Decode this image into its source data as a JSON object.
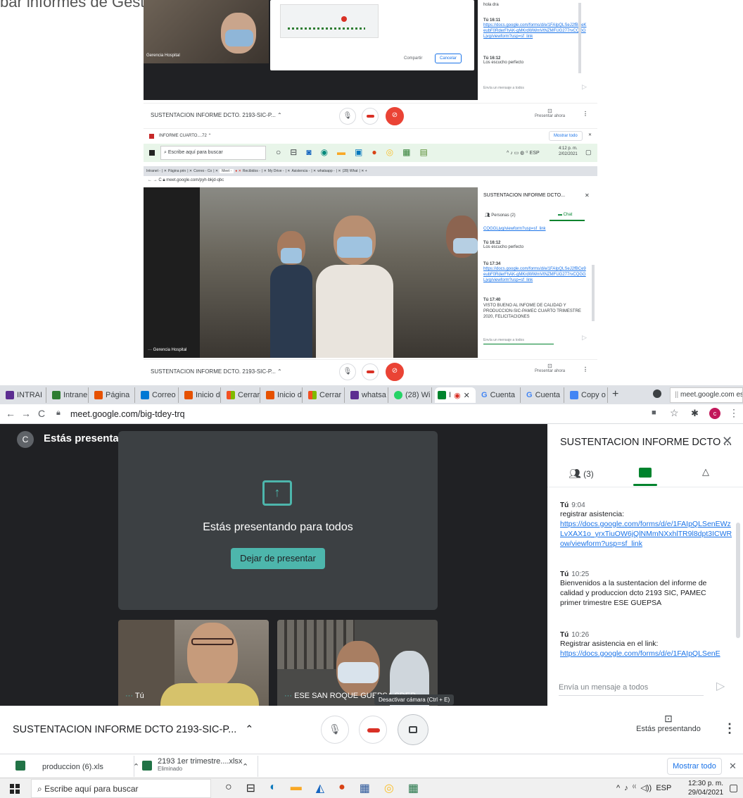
{
  "top_banner_text": "bar informes de Gestion de la Ese en el pandemia para hablar del sector salud",
  "shot1": {
    "participant_name": "Gerencia Hospital",
    "dialog_buttons": [
      "Compartir",
      "Cancelar"
    ],
    "chat": [
      {
        "sender": "",
        "time": "",
        "text": "hola dra"
      },
      {
        "sender": "Tú",
        "time": "16:11",
        "link": "https://docs.google.com/forms/d/e/1FAIpQLSeJ2fBCeKeubF0RderFhAK-gMKrdWWmVtNZMFUG277rvCQGGLjvg/viewform?usp=sf_link"
      },
      {
        "sender": "Tú",
        "time": "16:12",
        "text": "Los escucho perfecto"
      }
    ],
    "chat_placeholder": "Envía un mensaje a todos",
    "meeting_title": "SUSTENTACION INFORME DCTO. 2193-SIC-P...",
    "present_label": "Presentar ahora",
    "download_file": "INFORME CUARTO....72",
    "show_all": "Mostrar todo",
    "search": "Escribe aquí para buscar",
    "clock": "4:12 p. m.",
    "date": "2/02/2021",
    "lang": "ESP"
  },
  "shot2": {
    "tabs": [
      "Intranet - ",
      "Página prin",
      "Correo - Co",
      "Meet -",
      "Recibidos -",
      "My Drive -",
      "Asistencia -",
      "whatsapp -",
      "(28) What"
    ],
    "url": "meet.google.com/pyh-bkjd-qbc",
    "panel_title": "SUSTENTACION INFORME DCTO...",
    "people_tab": "Personas (2)",
    "chat_tab": "Chat",
    "chat": [
      {
        "sender": "",
        "time": "",
        "link": "CQGGLjvg/viewform?usp=sf_link"
      },
      {
        "sender": "Tú",
        "time": "16:12",
        "text": "Los escucho perfecto"
      },
      {
        "sender": "Tú",
        "time": "17:34",
        "link": "https://docs.google.com/forms/d/e/1FAIpQLSeJ2fBCe9eubF0RderFhAK-gMKrdWWmVtNZMFUG277rvCQGGLjvg/viewform?usp=sf_link"
      },
      {
        "sender": "Tú",
        "time": "17:40",
        "text": "VISTO BUENO AL INFOME DE CALIDAD Y PRODUCCION-SIC-PAMEC CUARTO TRIMESTRE 2020, FELICITACIONES"
      }
    ],
    "chat_placeholder": "Envía un mensaje a todos",
    "participant_name": "Gerencia Hospital",
    "meeting_title": "SUSTENTACION INFORME DCTO. 2193-SIC-P...",
    "present_label": "Presentar ahora"
  },
  "tabs": [
    {
      "label": "INTRAI",
      "color": "#5c2d91"
    },
    {
      "label": "Intrane",
      "color": "#2e7d32"
    },
    {
      "label": "Página",
      "color": "#e65100"
    },
    {
      "label": "Correo",
      "color": "#0078d4"
    },
    {
      "label": "Inicio d",
      "color": "#e65100"
    },
    {
      "label": "Cerrar",
      "color": "#f25022"
    },
    {
      "label": "Inicio d",
      "color": "#e65100"
    },
    {
      "label": "Cerrar",
      "color": "#f25022"
    },
    {
      "label": "whatsa",
      "color": "#5c2d91"
    },
    {
      "label": "(28) Wi",
      "color": "#25d366"
    },
    {
      "label": "I",
      "color": "#00832d"
    },
    {
      "label": "Cuenta",
      "color": "#4285f4"
    },
    {
      "label": "Cuenta",
      "color": "#4285f4"
    },
    {
      "label": "Copy o",
      "color": "#4285f4"
    }
  ],
  "tab_tooltip": "meet.google.com est",
  "url": "meet.google.com/big-tdey-trq",
  "presenting_header": "Estás presentando",
  "avatar_letter": "C",
  "presenting_card": {
    "text": "Estás presentando para todos",
    "button": "Dejar de presentar"
  },
  "tiles": [
    {
      "name": "Tú"
    },
    {
      "name": "ESE SAN ROQUE GUEPSA SDER"
    }
  ],
  "panel": {
    "title": "SUSTENTACION INFORME DCTO ...",
    "people_count": "(3)",
    "messages": [
      {
        "sender": "Tú",
        "time": "9:04",
        "text": "registrar asistencia:",
        "link": "https://docs.google.com/forms/d/e/1FAIpQLSenEWzLvXAX1o_yrxTiuOW6jQlNMmNXxhlTR9l8dpt3ICWRow/viewform?usp=sf_link"
      },
      {
        "sender": "Tú",
        "time": "10:25",
        "text": "Bienvenidos a la sustentacion del informe de calidad y produccion dcto 2193 SIC, PAMEC primer trimestre ESE GUEPSA",
        "link": ""
      },
      {
        "sender": "Tú",
        "time": "10:26",
        "text": "Registrar asistencia en el link:",
        "link": "https://docs.google.com/forms/d/e/1FAIpQLSenE"
      }
    ],
    "input_placeholder": "Envía un mensaje a todos"
  },
  "bottom": {
    "meeting_title": "SUSTENTACION INFORME DCTO 2193-SIC-P...",
    "tooltip": "Desactivar cámara (Ctrl + E)",
    "presenting_label": "Estás presentando"
  },
  "downloads": [
    {
      "name": "produccion (6).xls",
      "status": ""
    },
    {
      "name": "2193 1er trimestre....xlsx",
      "status": "Eliminado"
    }
  ],
  "show_all": "Mostrar todo",
  "taskbar": {
    "search": "Escribe aquí para buscar",
    "lang": "ESP",
    "time": "12:30 p. m.",
    "date": "29/04/2021"
  }
}
